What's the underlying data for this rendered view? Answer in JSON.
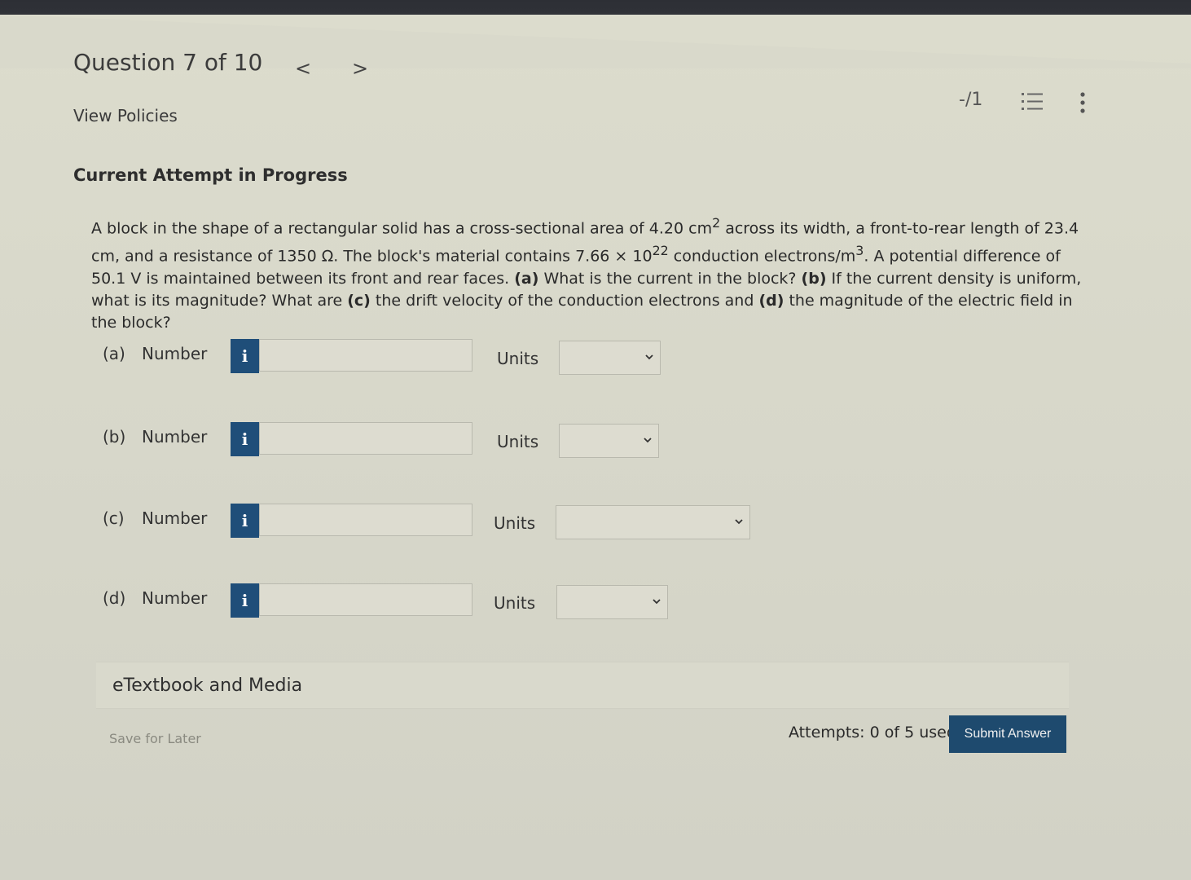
{
  "header": {
    "question_title": "Question 7 of 10",
    "prev_glyph": "<",
    "next_glyph": ">",
    "view_policies": "View Policies",
    "score": "-/1",
    "list_icon": "list-icon",
    "more_icon": "more-vertical-icon"
  },
  "attempt_heading": "Current Attempt in Progress",
  "problem": {
    "t1": "A block in the shape of a rectangular solid has a cross-sectional area of 4.20 cm",
    "sup1": "2",
    "t2": " across its width, a front-to-rear length of 23.4 cm, and a resistance of 1350 Ω. The block's material contains 7.66 × 10",
    "sup2": "22",
    "t3": " conduction electrons/m",
    "sup3": "3",
    "t4": ". A potential difference of 50.1 V is maintained between its front and rear faces. ",
    "a_label": "(a)",
    "t5": " What is the current in the block? ",
    "b_label": "(b)",
    "t6": " If the current density is uniform, what is its magnitude? What are ",
    "c_label": "(c)",
    "t7": " the drift velocity of the conduction electrons and ",
    "d_label": "(d)",
    "t8": " the magnitude of the electric field in the block?"
  },
  "parts": [
    {
      "label": "(a)",
      "number_label": "Number",
      "info": "i",
      "value": "",
      "units_label": "Units",
      "units_value": ""
    },
    {
      "label": "(b)",
      "number_label": "Number",
      "info": "i",
      "value": "",
      "units_label": "Units",
      "units_value": ""
    },
    {
      "label": "(c)",
      "number_label": "Number",
      "info": "i",
      "value": "",
      "units_label": "Units",
      "units_value": ""
    },
    {
      "label": "(d)",
      "number_label": "Number",
      "info": "i",
      "value": "",
      "units_label": "Units",
      "units_value": ""
    }
  ],
  "etextbook": "eTextbook and Media",
  "footer": {
    "save_for_later": "Save for Later",
    "attempts": "Attempts: 0 of 5 used",
    "submit": "Submit Answer"
  }
}
